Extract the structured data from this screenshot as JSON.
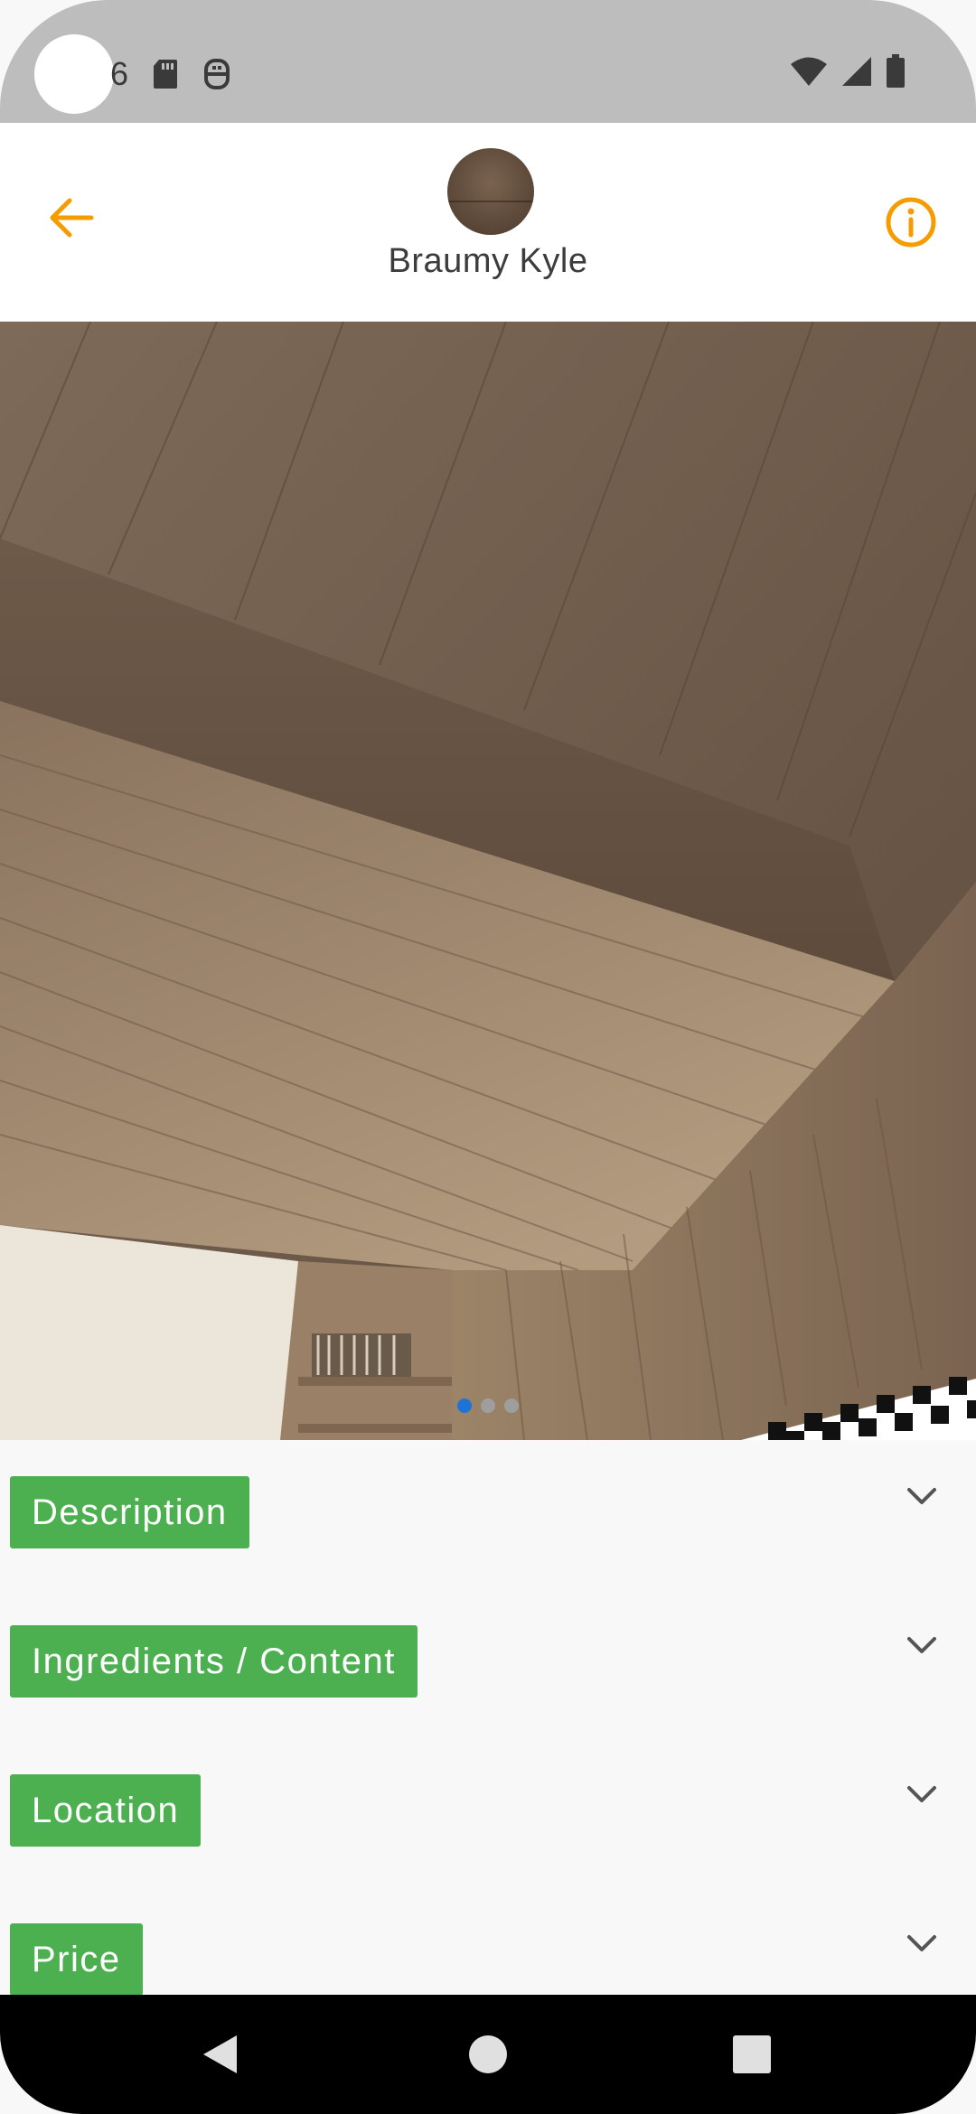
{
  "status_bar": {
    "time": "6",
    "icons": [
      "sd-card-icon",
      "robot-icon",
      "wifi-icon",
      "signal-icon",
      "battery-icon"
    ]
  },
  "header": {
    "user_name": "Braumy Kyle",
    "back_icon": "arrow-left-icon",
    "info_icon": "info-circle-icon",
    "accent_color": "#f59c00"
  },
  "gallery": {
    "page_count": 3,
    "active_index": 0,
    "active_dot_color": "#1e74d6"
  },
  "sections": [
    {
      "label": "Description"
    },
    {
      "label": "Ingredients / Content"
    },
    {
      "label": "Location"
    },
    {
      "label": "Price"
    }
  ],
  "section_tag_color": "#4caf50",
  "nav_bar": {
    "buttons": [
      "back-triangle-icon",
      "home-circle-icon",
      "recents-square-icon"
    ]
  }
}
